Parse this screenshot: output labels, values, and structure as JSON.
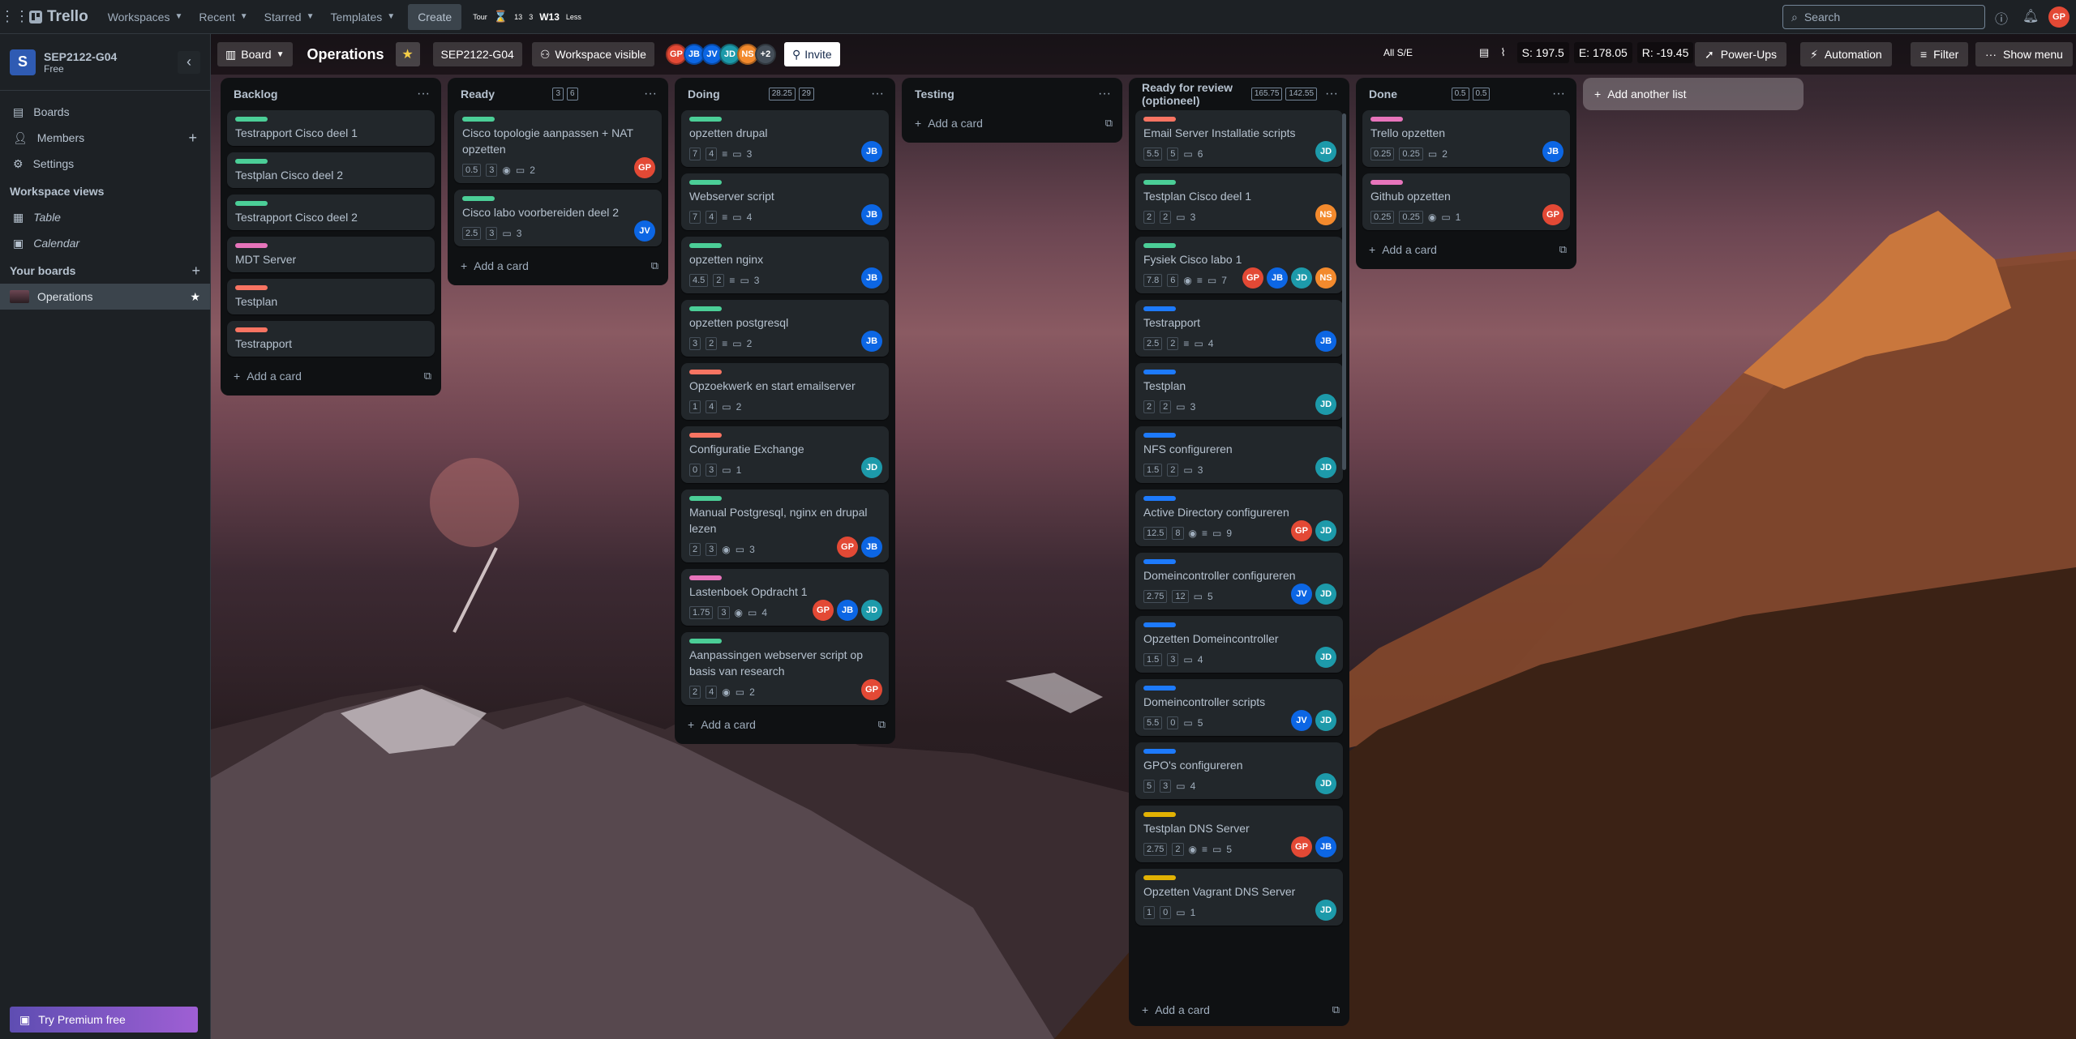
{
  "colors": {
    "accent": "#0c66e4",
    "gp": "#e34935",
    "jb": "#0c66e4",
    "jd": "#1d9aaa",
    "ns": "#f38a2d"
  },
  "topnav": {
    "app_name": "Trello",
    "workspaces": "Workspaces",
    "recent": "Recent",
    "starred": "Starred",
    "templates": "Templates",
    "create": "Create",
    "ext_tour": "Tour",
    "ext_w13": "W13",
    "ext_less": "Less",
    "ext_num1": "13",
    "ext_num2": "3",
    "search_placeholder": "Search",
    "user_initials": "GP"
  },
  "sidebar": {
    "workspace_initial": "S",
    "workspace_name": "SEP2122-G04",
    "workspace_plan": "Free",
    "items": [
      {
        "label": "Boards",
        "icon": "board-icon"
      },
      {
        "label": "Members",
        "icon": "members-icon"
      },
      {
        "label": "Settings",
        "icon": "gear-icon"
      }
    ],
    "views_title": "Workspace views",
    "views": [
      {
        "label": "Table",
        "icon": "table-icon"
      },
      {
        "label": "Calendar",
        "icon": "calendar-icon"
      }
    ],
    "your_boards": "Your boards",
    "boards": [
      {
        "label": "Operations"
      }
    ],
    "premium": "Try Premium free"
  },
  "boardbar": {
    "view": "Board",
    "title": "Operations",
    "workspace": "SEP2122-G04",
    "visibility": "Workspace visible",
    "members": [
      "GP",
      "JB",
      "JV",
      "JD",
      "NS"
    ],
    "more": "+2",
    "invite": "Invite",
    "all_se": "All S/E",
    "s": "S: 197.5",
    "e": "E: 178.05",
    "r": "R: -19.45",
    "powerups": "Power-Ups",
    "automation": "Automation",
    "filter": "Filter",
    "show_menu": "Show menu"
  },
  "add_card": "Add a card",
  "add_list": "Add another list",
  "lists": [
    {
      "title": "Backlog",
      "cards": [
        {
          "label": "green",
          "title": "Testrapport Cisco deel 1"
        },
        {
          "label": "green",
          "title": "Testplan Cisco deel 2"
        },
        {
          "label": "green",
          "title": "Testrapport Cisco deel 2"
        },
        {
          "label": "pink",
          "title": "MDT Server"
        },
        {
          "label": "red",
          "title": "Testplan"
        },
        {
          "label": "red",
          "title": "Testrapport"
        }
      ]
    },
    {
      "title": "Ready",
      "limits": [
        "3",
        "6"
      ],
      "cards": [
        {
          "label": "green",
          "title": "Cisco topologie aanpassen + NAT opzetten",
          "s": "0.5",
          "e": "3",
          "watch": true,
          "comments": "2",
          "members": [
            "GP"
          ]
        },
        {
          "label": "green",
          "title": "Cisco labo voorbereiden deel 2",
          "s": "2.5",
          "e": "3",
          "comments": "3",
          "members": [
            "JV"
          ]
        }
      ]
    },
    {
      "title": "Doing",
      "limits": [
        "28.25",
        "29"
      ],
      "cards": [
        {
          "label": "green",
          "title": "opzetten drupal",
          "s": "7",
          "e": "4",
          "desc": true,
          "comments": "3",
          "members": [
            "JB"
          ]
        },
        {
          "label": "green",
          "title": "Webserver script",
          "s": "7",
          "e": "4",
          "desc": true,
          "comments": "4",
          "members": [
            "JB"
          ]
        },
        {
          "label": "green",
          "title": "opzetten nginx",
          "s": "4.5",
          "e": "2",
          "desc": true,
          "comments": "3",
          "members": [
            "JB"
          ]
        },
        {
          "label": "green",
          "title": "opzetten postgresql",
          "s": "3",
          "e": "2",
          "desc": true,
          "comments": "2",
          "members": [
            "JB"
          ]
        },
        {
          "label": "red",
          "title": "Opzoekwerk en start emailserver",
          "s": "1",
          "e": "4",
          "comments": "2",
          "members": []
        },
        {
          "label": "red",
          "title": "Configuratie Exchange",
          "s": "0",
          "e": "3",
          "comments": "1",
          "members": [
            "JD"
          ]
        },
        {
          "label": "green",
          "title": "Manual Postgresql, nginx en drupal lezen",
          "s": "2",
          "e": "3",
          "watch": true,
          "comments": "3",
          "members": [
            "GP",
            "JB"
          ]
        },
        {
          "label": "pink",
          "title": "Lastenboek Opdracht 1",
          "s": "1.75",
          "e": "3",
          "watch": true,
          "comments": "4",
          "members": [
            "GP",
            "JB",
            "JD"
          ]
        },
        {
          "label": "green",
          "title": "Aanpassingen webserver script op basis van research",
          "s": "2",
          "e": "4",
          "watch": true,
          "comments": "2",
          "members": [
            "GP"
          ]
        }
      ]
    },
    {
      "title": "Testing",
      "cards": []
    },
    {
      "title": "Ready for review (optioneel)",
      "limits": [
        "165.75",
        "142.55"
      ],
      "cards": [
        {
          "label": "red",
          "title": "Email Server Installatie scripts",
          "s": "5.5",
          "e": "5",
          "comments": "6",
          "members": [
            "JD"
          ]
        },
        {
          "label": "green",
          "title": "Testplan Cisco deel 1",
          "s": "2",
          "e": "2",
          "comments": "3",
          "members": [
            "NS"
          ]
        },
        {
          "label": "green",
          "title": "Fysiek Cisco labo 1",
          "s": "7.8",
          "e": "6",
          "watch": true,
          "desc": true,
          "comments": "7",
          "members": [
            "GP",
            "JB",
            "JD",
            "NS"
          ]
        },
        {
          "label": "blue",
          "title": "Testrapport",
          "s": "2.5",
          "e": "2",
          "desc": true,
          "comments": "4",
          "members": [
            "JB"
          ]
        },
        {
          "label": "blue",
          "title": "Testplan",
          "s": "2",
          "e": "2",
          "comments": "3",
          "members": [
            "JD"
          ]
        },
        {
          "label": "blue",
          "title": "NFS configureren",
          "s": "1.5",
          "e": "2",
          "comments": "3",
          "members": [
            "JD"
          ]
        },
        {
          "label": "blue",
          "title": "Active Directory configureren",
          "s": "12.5",
          "e": "8",
          "watch": true,
          "desc": true,
          "comments": "9",
          "members": [
            "GP",
            "JD"
          ]
        },
        {
          "label": "blue",
          "title": "Domeincontroller configureren",
          "s": "2.75",
          "e": "12",
          "comments": "5",
          "members": [
            "JV",
            "JD"
          ]
        },
        {
          "label": "blue",
          "title": "Opzetten Domeincontroller",
          "s": "1.5",
          "e": "3",
          "comments": "4",
          "members": [
            "JD"
          ]
        },
        {
          "label": "blue",
          "title": "Domeincontroller scripts",
          "s": "5.5",
          "e": "0",
          "comments": "5",
          "members": [
            "JV",
            "JD"
          ]
        },
        {
          "label": "blue",
          "title": "GPO's configureren",
          "s": "5",
          "e": "3",
          "comments": "4",
          "members": [
            "JD"
          ]
        },
        {
          "label": "yellow",
          "title": "Testplan DNS Server",
          "s": "2.75",
          "e": "2",
          "watch": true,
          "desc": true,
          "comments": "5",
          "members": [
            "GP",
            "JB"
          ]
        },
        {
          "label": "yellow",
          "title": "Opzetten Vagrant DNS Server",
          "s": "1",
          "e": "0",
          "comments": "1",
          "members": [
            "JD"
          ]
        }
      ]
    },
    {
      "title": "Done",
      "limits": [
        "0.5",
        "0.5"
      ],
      "cards": [
        {
          "label": "pink",
          "title": "Trello opzetten",
          "s": "0.25",
          "e": "0.25",
          "comments": "2",
          "members": [
            "JB"
          ]
        },
        {
          "label": "pink",
          "title": "Github opzetten",
          "s": "0.25",
          "e": "0.25",
          "watch": true,
          "comments": "1",
          "members": [
            "GP"
          ]
        }
      ]
    }
  ]
}
